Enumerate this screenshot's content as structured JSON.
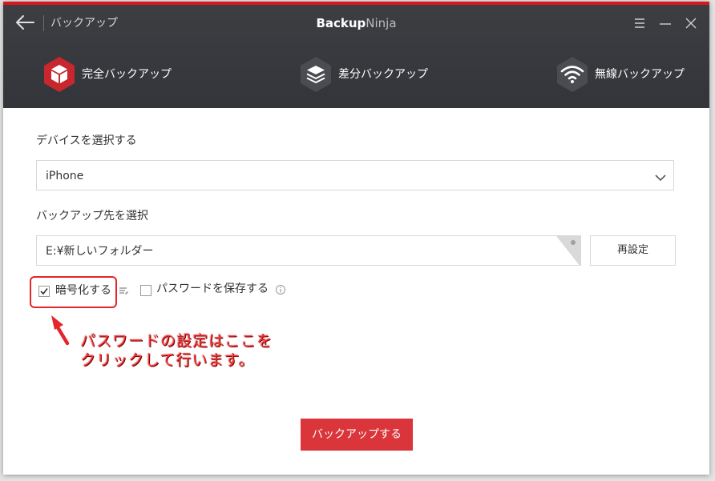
{
  "titlebar": {
    "page_title": "バックアップ",
    "app_title_bold": "Backup",
    "app_title_light": "Ninja"
  },
  "modes": [
    {
      "label": "完全バックアップ",
      "icon": "cube-icon",
      "active": true
    },
    {
      "label": "差分バックアップ",
      "icon": "layers-icon",
      "active": false
    },
    {
      "label": "無線バックアップ",
      "icon": "wifi-icon",
      "active": false
    }
  ],
  "device": {
    "label": "デバイスを選択する",
    "selected": "iPhone"
  },
  "destination": {
    "label": "バックアップ先を選択",
    "path": "E:¥新しいフォルダー",
    "reset_label": "再設定"
  },
  "options": {
    "encrypt_label": "暗号化する",
    "encrypt_checked": true,
    "save_password_label": "パスワードを保存する",
    "save_password_checked": false
  },
  "annotation": {
    "line1": "パスワードの設定はここを",
    "line2": "クリックして行います。"
  },
  "action": {
    "backup_label": "バックアップする"
  },
  "colors": {
    "accent": "#d9353a",
    "header_bg": "#36383c",
    "highlight": "#e4252b"
  }
}
